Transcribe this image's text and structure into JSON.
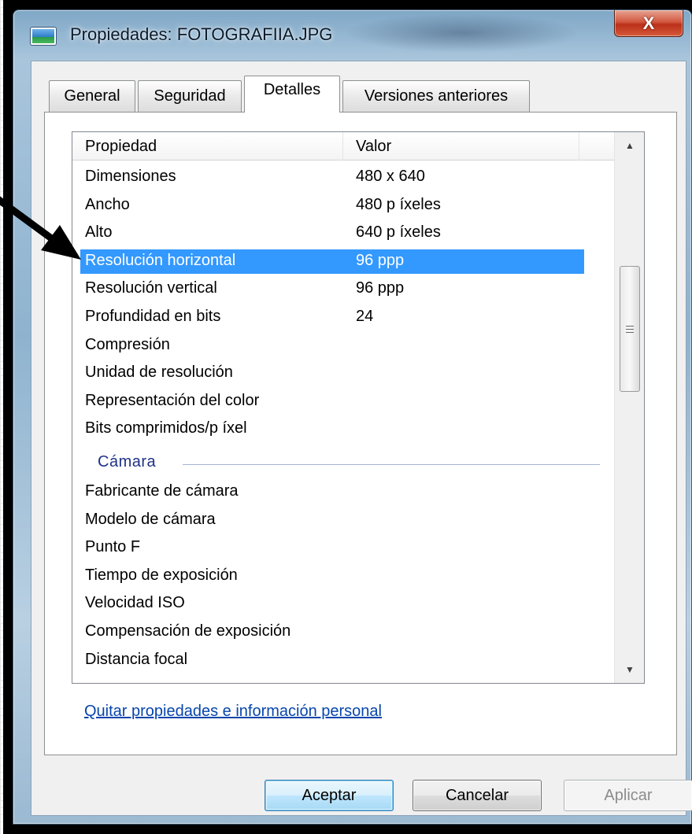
{
  "window": {
    "title": "Propiedades: FOTOGRAFIIA.JPG",
    "close_glyph": "X"
  },
  "tabs": [
    {
      "label": "General"
    },
    {
      "label": "Seguridad"
    },
    {
      "label": "Detalles"
    },
    {
      "label": "Versiones anteriores"
    }
  ],
  "list": {
    "headers": {
      "property": "Propiedad",
      "value": "Valor"
    },
    "rows": [
      {
        "property": "Dimensiones",
        "value": "480 x 640"
      },
      {
        "property": "Ancho",
        "value": "480 p íxeles"
      },
      {
        "property": "Alto",
        "value": "640 p íxeles"
      },
      {
        "property": "Resolución horizontal",
        "value": "96 ppp"
      },
      {
        "property": "Resolución vertical",
        "value": "96 ppp"
      },
      {
        "property": "Profundidad en bits",
        "value": "24"
      },
      {
        "property": "Compresión",
        "value": ""
      },
      {
        "property": "Unidad de resolución",
        "value": ""
      },
      {
        "property": "Representación del color",
        "value": ""
      },
      {
        "property": "Bits comprimidos/p íxel",
        "value": ""
      }
    ],
    "group_label": "Cámara",
    "group_rows": [
      {
        "property": "Fabricante de cámara",
        "value": ""
      },
      {
        "property": "Modelo de cámara",
        "value": ""
      },
      {
        "property": "Punto F",
        "value": ""
      },
      {
        "property": "Tiempo de exposición",
        "value": ""
      },
      {
        "property": "Velocidad ISO",
        "value": ""
      },
      {
        "property": "Compensación de exposición",
        "value": ""
      },
      {
        "property": "Distancia focal",
        "value": ""
      }
    ],
    "selected_property": "Resolución horizontal"
  },
  "link_text": "Quitar propiedades e información personal",
  "buttons": {
    "accept": "Aceptar",
    "cancel": "Cancelar",
    "apply": "Aplicar"
  },
  "colors": {
    "selection": "#3399ff",
    "group_label": "#1e3287",
    "link": "#0645ad"
  }
}
